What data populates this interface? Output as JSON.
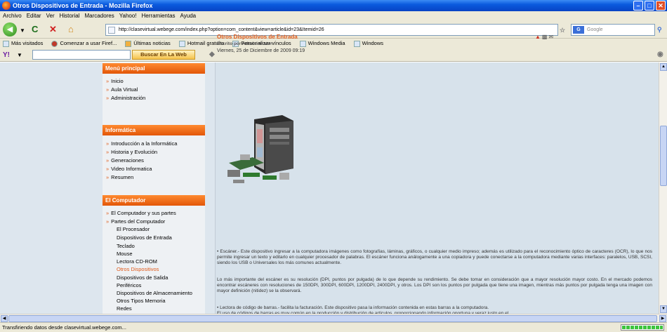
{
  "window": {
    "title": "Otros Dispositivos de Entrada - Mozilla Firefox"
  },
  "menubar": [
    "Archivo",
    "Editar",
    "Ver",
    "Historial",
    "Marcadores",
    "Yahoo!",
    "Herramientas",
    "Ayuda"
  ],
  "nav": {
    "url": "http://clasevirtual.webege.com/index.php?option=com_content&view=article&id=23&Itemid=26",
    "search_placeholder": "Google"
  },
  "bookmarks": [
    "Más visitados",
    "Comenzar a usar Firef...",
    "Últimas noticias",
    "Hotmail gratuito",
    "Personalizar vínculos",
    "Windows Media",
    "Windows"
  ],
  "yahoo": {
    "logo": "Y!",
    "search_button": "Buscar En La Web"
  },
  "sidebar": {
    "menu_principal": {
      "title": "Menú principal",
      "items": [
        "Inicio",
        "Aula Virtual",
        "Administración"
      ]
    },
    "informatica": {
      "title": "Informática",
      "items": [
        "Introducción a la Informática",
        "Historia y Evolución",
        "Generaciones",
        "Video Informatica",
        "Resumen"
      ]
    },
    "computador": {
      "title": "El Computador",
      "items": [
        "El Computador y sus partes",
        "Partes del Computador"
      ],
      "subitems": [
        "El Procesador",
        "Dispositivos de Entrada",
        "Teclado",
        "Mouse",
        "Lectora CD-ROM",
        "Otros Dispositivos",
        "Dispositivos de Salida",
        "Periféricos",
        "Dispositivos de Almacenamiento",
        "Otros Tipos Memoria",
        "Redes"
      ],
      "active_subitem": "Otros Dispositivos"
    }
  },
  "article": {
    "title": "Otros Dispositivos de Entrada",
    "author": "Escrito por Administrator",
    "date": "Viernes, 25 de Diciembre de 2009 09:19",
    "paragraphs": [
      "• Escáner.- Este dispositivo ingresar a la computadora imágenes como fotografías, láminas, gráficos, o cualquier medio impreso; además es utilizado para el reconocimiento óptico de caracteres (OCR), lo que nos permite ingresar un texto y editarlo en cualquier procesador de palabras. El escáner funciona análogamente a una copiadora y puede conectarse a la computadora mediante varias interfaces: paralelos, USB, SCSI, siendo los USB o Universales los más comunes actualmente.",
      "Lo más importante del escáner es su resolución (DPI, puntos por pulgada) de lo que depende su rendimiento. Se debe tomar en consideración que a mayor resolución mayor costo. En el mercado podemos encontrar escáneres con resoluciones de 150DPI, 300DPI, 600DPI, 1200DPI, 2400DPI, y otros. Los DPI son los puntos por pulgada que tiene una imagen, mientras más puntos por pulgada tenga una imagen con mayor definición (nitidez) se la observará.",
      "• Lectora de código de barras.- facilita la facturación. Este dispositivo pasa la información contenida en estas barras a la computadora.",
      "El uso de códigos de barras es muy común en la producción y distribución de artículos, proporcionando información oportuna y veraz justo en el"
    ]
  },
  "status": {
    "text": "Transfiriendo datos desde clasevirtual.webege.com..."
  }
}
